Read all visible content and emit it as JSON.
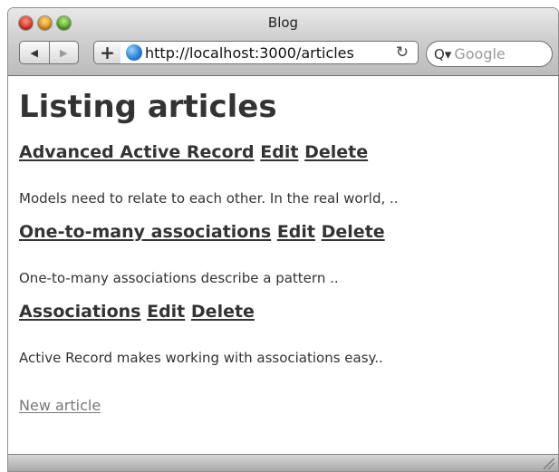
{
  "window": {
    "title": "Blog"
  },
  "toolbar": {
    "back_icon": "◀",
    "forward_icon": "▶",
    "add_icon": "+",
    "url": "http://localhost:3000/articles",
    "reload_icon": "↻",
    "search_placeholder": "Google",
    "search_icon": "Q▾"
  },
  "page": {
    "heading": "Listing articles",
    "new_article": "New article",
    "articles": [
      {
        "title": "Advanced Active Record",
        "edit": "Edit",
        "delete": "Delete",
        "body": "Models need to relate to each other. In the real world, .."
      },
      {
        "title": "One-to-many associations",
        "edit": "Edit",
        "delete": "Delete",
        "body": "One-to-many associations describe a pattern .."
      },
      {
        "title": "Associations",
        "edit": "Edit",
        "delete": "Delete",
        "body": "Active Record makes working with associations easy.."
      }
    ]
  },
  "colors": {
    "text": "#333333",
    "visited_link": "#6f6f6f",
    "active_link": "#111111",
    "chrome": "#cfcfcf"
  }
}
